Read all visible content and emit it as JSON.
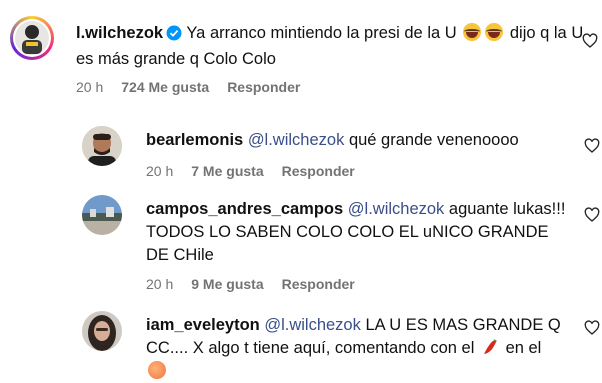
{
  "comments": [
    {
      "username": "l.wilchezok",
      "verified": true,
      "text_before": "Ya arranco mintiendo la presi de la U",
      "emoji_1": "laughing-tears-emoji",
      "emoji_2": "laughing-tears-emoji",
      "text_after": "dijo q la U es más grande q Colo Colo",
      "time": "20 h",
      "likes": "724 Me gusta",
      "reply": "Responder"
    },
    {
      "username": "bearlemonis",
      "mention": "@l.wilchezok",
      "text": "qué grande venenoooo",
      "time": "20 h",
      "likes": "7 Me gusta",
      "reply": "Responder"
    },
    {
      "username": "campos_andres_campos",
      "mention": "@l.wilchezok",
      "text": "aguante lukas!!! TODOS LO SABEN COLO COLO EL uNICO GRANDE DE CHile",
      "time": "20 h",
      "likes": "9 Me gusta",
      "reply": "Responder"
    },
    {
      "username": "iam_eveleyton",
      "mention": "@l.wilchezok",
      "text_before": "LA U ES MAS GRANDE Q CC.... X algo t tiene aquí, comentando con el",
      "emoji_1": "chili-pepper-emoji",
      "text_after": "en el",
      "emoji_2": "peach-emoji"
    }
  ],
  "colors": {
    "mention": "#3a4f8a",
    "meta": "#737373",
    "verified": "#0095f6"
  }
}
